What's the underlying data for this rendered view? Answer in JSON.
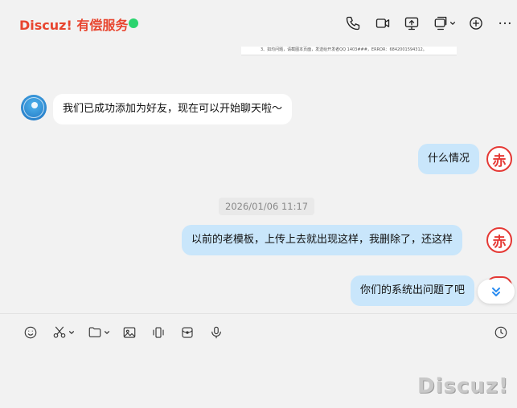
{
  "header": {
    "title": "Discuz! 有偿服务",
    "status_color": "#2bd46e",
    "title_color": "#e8452f"
  },
  "doc_preview": {
    "text": "3、如均问题，请截图本页面，发送给开发者QQ 1403###，ERROR：6842001594312。"
  },
  "messages": [
    {
      "side": "in",
      "text": "我们已成功添加为好友，现在可以开始聊天啦～",
      "avatar": "blue-avatar"
    },
    {
      "side": "out",
      "text": "什么情况",
      "avatar": "red-avatar"
    },
    {
      "side": "out",
      "text": "以前的老模板，上传上去就出现这样，我删除了，还这样",
      "avatar": "red-avatar"
    },
    {
      "side": "out",
      "text": "你们的系统出问题了吧",
      "avatar": "red-avatar"
    }
  ],
  "timestamp": "2026/01/06 11:17",
  "avatar_red_glyph": "赤",
  "watermark": "Discuz!",
  "colors": {
    "bubble_out": "#c9e6fb",
    "bubble_in": "#ffffff",
    "accent": "#2a8cf0"
  }
}
